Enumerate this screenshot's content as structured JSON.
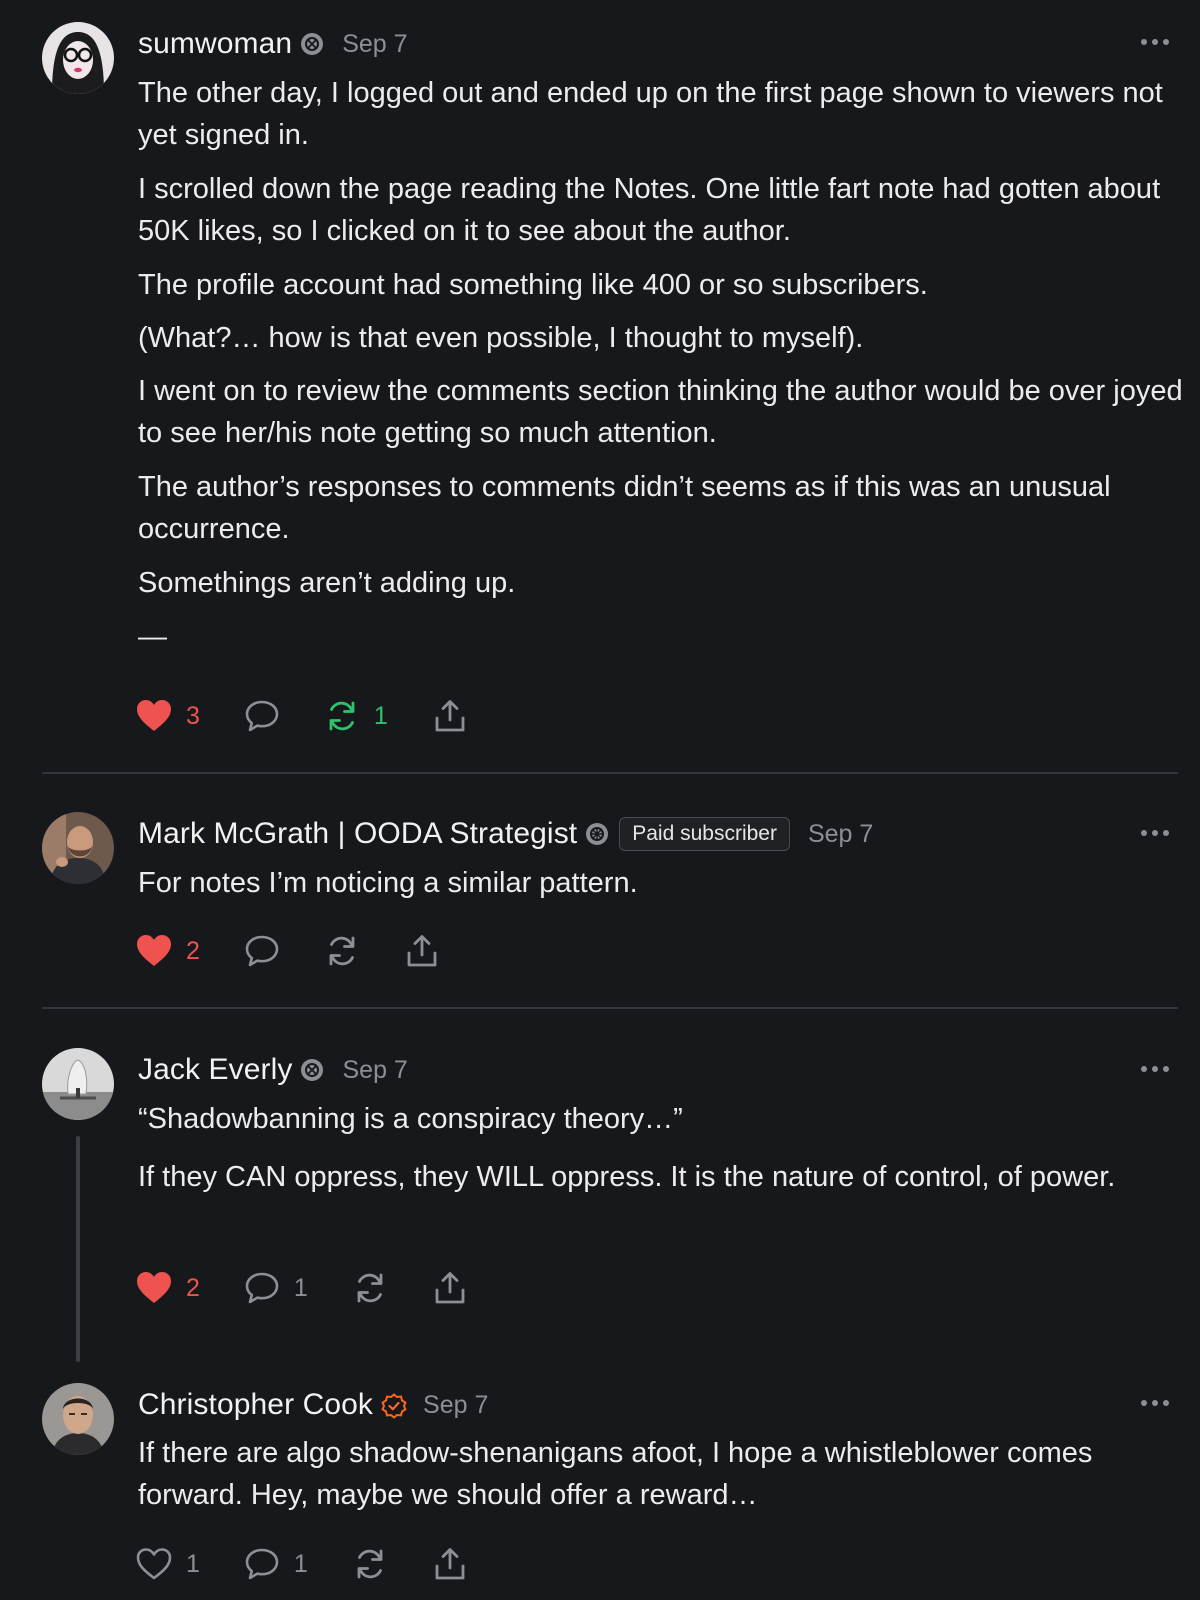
{
  "comments": [
    {
      "author": "sumwoman",
      "badge": "subscriber-badge-icon",
      "date": "Sep 7",
      "paragraphs": [
        "The other day, I logged out and ended up on the first page shown to viewers not yet signed in.",
        "I scrolled down the page reading the Notes. One little fart note had gotten about 50K likes, so I clicked on it to see about the author.",
        "The profile account had something like 400 or so subscribers.",
        "(What?… how is that even possible, I thought to myself).",
        "I went on to review the comments section thinking the author would be over joyed to see her/his note getting so much attention.",
        "The author’s responses to comments didn’t seems as if this was an unusual occurrence.",
        "Somethings aren’t adding up.",
        "—"
      ],
      "likes": "3",
      "restacks": "1",
      "liked": true,
      "restacked": true
    },
    {
      "author": "Mark McGrath | OODA Strategist",
      "badge": "subscriber-badge-icon",
      "pill": "Paid subscriber",
      "date": "Sep 7",
      "paragraphs": [
        "For notes I’m noticing a similar pattern."
      ],
      "likes": "2",
      "liked": true
    },
    {
      "author": "Jack Everly",
      "badge": "subscriber-badge-icon",
      "date": "Sep 7",
      "paragraphs": [
        "“Shadowbanning is a conspiracy theory…”",
        "If they CAN oppress, they WILL oppress. It is the nature of control, of power."
      ],
      "likes": "2",
      "replies": "1",
      "liked": true
    },
    {
      "author": "Christopher Cook",
      "badge": "verified-check-icon",
      "date": "Sep 7",
      "paragraphs": [
        "If there are algo shadow-shenanigans afoot, I hope a whistleblower comes forward. Hey, maybe we should offer a reward…"
      ],
      "likes": "1",
      "replies": "1",
      "liked": false
    }
  ],
  "colors": {
    "background": "#17181b",
    "like": "#ef5350",
    "restack": "#2fc26b",
    "muted": "#8e8f94",
    "verified": "#ff6719"
  }
}
